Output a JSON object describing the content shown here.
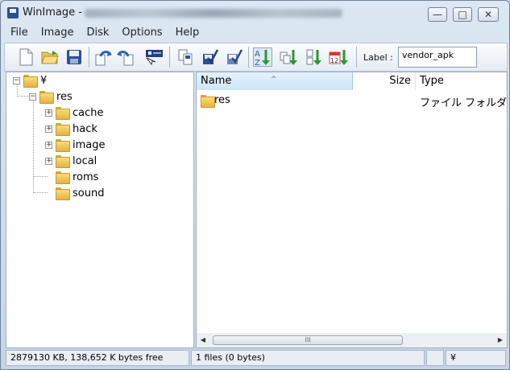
{
  "window": {
    "title": "WinImage -",
    "controls": {
      "minimize": "—",
      "maximize": "□",
      "close": "✕"
    }
  },
  "menu": [
    "File",
    "Image",
    "Disk",
    "Options",
    "Help"
  ],
  "toolbar": {
    "icons": [
      "new-image-icon",
      "open-icon",
      "save-icon",
      "inject-icon",
      "extract-icon",
      "properties-icon",
      "copy-icon",
      "check-icon",
      "check-all-icon",
      "sort-by-name-icon",
      "sort-by-ext-icon",
      "sort-by-size-icon",
      "sort-by-date-icon"
    ],
    "label_caption": "Label :",
    "label_value": "vendor_apk"
  },
  "tree": {
    "root": "¥",
    "res": "res",
    "children": [
      "cache",
      "hack",
      "image",
      "local",
      "roms",
      "sound"
    ],
    "expandable": [
      true,
      true,
      true,
      true,
      false,
      false
    ]
  },
  "list": {
    "columns": {
      "name": "Name",
      "size": "Size",
      "type": "Type"
    },
    "sort_indicator": "^",
    "rows": [
      {
        "name": "res",
        "size": "",
        "type": "ファイル フォルダー"
      }
    ]
  },
  "hscroll": {
    "left": "◀",
    "right": "▶",
    "grip": "III"
  },
  "status": {
    "disk": "2879130 KB, 138,652 K bytes free",
    "files": "1 files (0 bytes)",
    "extra": "",
    "path": "¥"
  },
  "colors": {
    "folder": "#e6b33e",
    "selected_header": "#cfe6f7",
    "chrome": "#c6d4e6"
  }
}
